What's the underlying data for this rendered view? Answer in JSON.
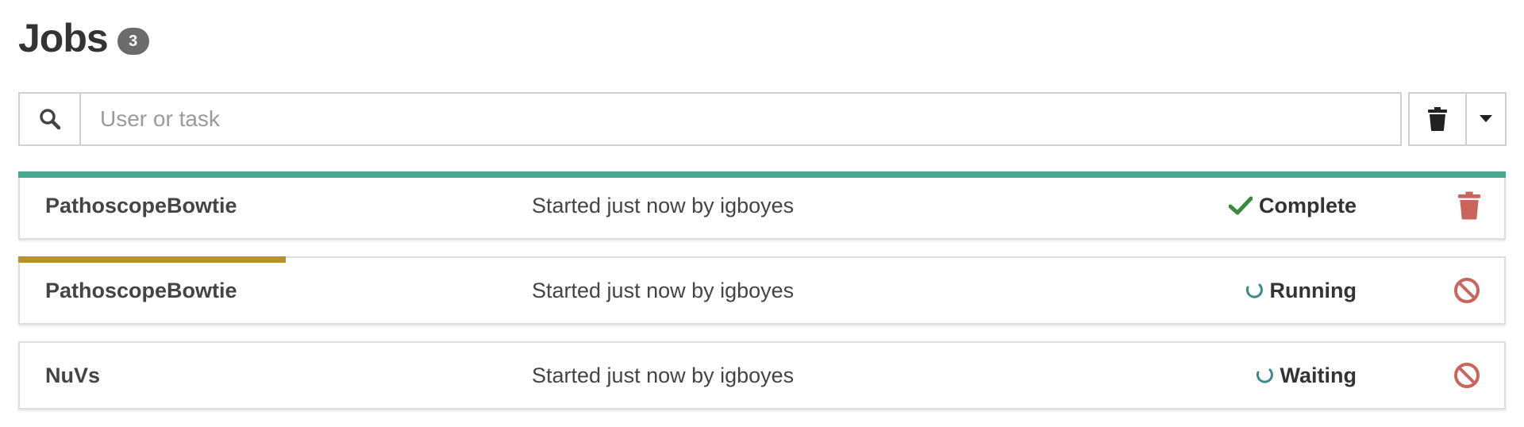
{
  "header": {
    "title": "Jobs",
    "count": "3"
  },
  "toolbar": {
    "search_placeholder": "User or task",
    "search_value": "",
    "icons": {
      "search": "search-icon",
      "clear": "trash-icon",
      "menu": "caret-down-icon"
    }
  },
  "jobs": [
    {
      "name": "PathoscopeBowtie",
      "description": "Started just now by igboyes",
      "status": "Complete",
      "status_icon": "check-icon",
      "progress": 1.0,
      "progress_color": "#4aa88f",
      "action_icon": "trash-icon",
      "action_color": "#c9655c"
    },
    {
      "name": "PathoscopeBowtie",
      "description": "Started just now by igboyes",
      "status": "Running",
      "status_icon": "spinner-icon",
      "progress": 0.18,
      "progress_color": "#b8922a",
      "action_icon": "ban-icon",
      "action_color": "#c9655c"
    },
    {
      "name": "NuVs",
      "description": "Started just now by igboyes",
      "status": "Waiting",
      "status_icon": "spinner-icon",
      "progress": 0,
      "progress_color": "#b8922a",
      "action_icon": "ban-icon",
      "action_color": "#c9655c"
    }
  ],
  "colors": {
    "complete_check": "#3b8a3b",
    "spinner": "#3a8a89",
    "danger": "#c9655c"
  }
}
